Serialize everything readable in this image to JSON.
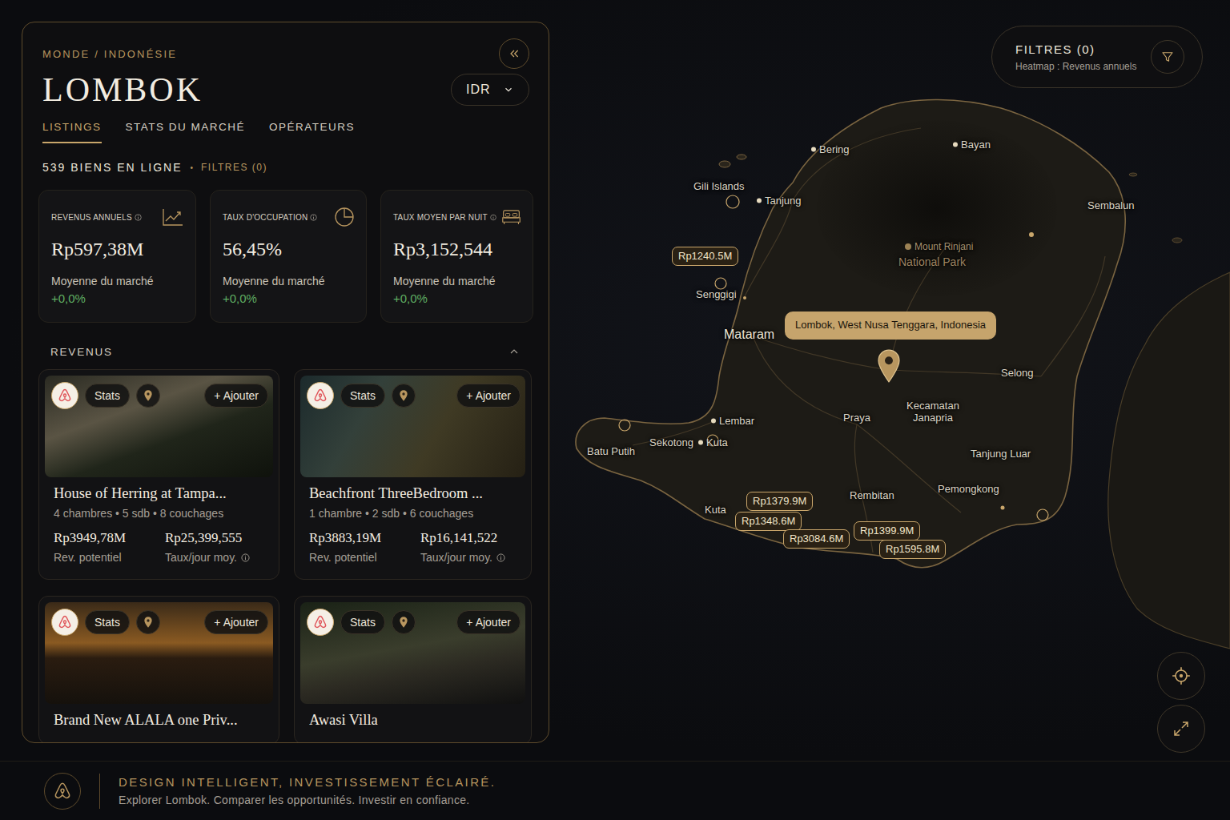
{
  "breadcrumb": "MONDE / INDONÉSIE",
  "title": "LOMBOK",
  "currency": {
    "value": "IDR"
  },
  "tabs": [
    {
      "label": "LISTINGS",
      "selected": true
    },
    {
      "label": "STATS DU MARCHÉ",
      "selected": false
    },
    {
      "label": "OPÉRATEURS",
      "selected": false
    }
  ],
  "summary": {
    "count": "539 BIENS EN LIGNE",
    "separator": "•",
    "filters": "FILTRES (0)"
  },
  "stats": [
    {
      "label": "REVENUS ANNUELS",
      "value": "Rp597,38M",
      "caption": "Moyenne du marché",
      "change": "+0,0%",
      "kind": "revenue"
    },
    {
      "label": "TAUX D'OCCUPATION",
      "value": "56,45%",
      "caption": "Moyenne du marché",
      "change": "+0,0%",
      "kind": "occupancy"
    },
    {
      "label": "TAUX MOYEN PAR NUIT",
      "value": "Rp3,152,544",
      "caption": "Moyenne du marché",
      "change": "+0,0%",
      "kind": "rate"
    }
  ],
  "section": {
    "title": "REVENUS",
    "expanded": true
  },
  "card_actions": {
    "stats": "Stats",
    "add": "+ Ajouter"
  },
  "listings": [
    {
      "title": "House of Herring at Tampa...",
      "details": "4 chambres • 5 sdb • 8 couchages",
      "potential": "Rp3949,78M",
      "potential_label": "Rev. potentiel",
      "rate": "Rp25,399,555",
      "rate_label": "Taux/jour moy."
    },
    {
      "title": "Beachfront ThreeBedroom ...",
      "details": "1 chambre • 2 sdb • 6 couchages",
      "potential": "Rp3883,19M",
      "potential_label": "Rev. potentiel",
      "rate": "Rp16,141,522",
      "rate_label": "Taux/jour moy."
    },
    {
      "title": "Brand New ALALA one Priv..."
    },
    {
      "title": "Awasi Villa"
    }
  ],
  "map": {
    "filters": {
      "title": "FILTRES (0)",
      "subtitle": "Heatmap : Revenus annuels"
    },
    "tooltip": "Lombok, West Nusa Tenggara, Indonesia",
    "places": [
      {
        "name": "Bering",
        "kind": "town",
        "marker": true
      },
      {
        "name": "Bayan",
        "kind": "town",
        "marker": true
      },
      {
        "name": "Gili Islands",
        "kind": "town",
        "marker": false
      },
      {
        "name": "Tanjung",
        "kind": "town",
        "marker": true
      },
      {
        "name": "Sembalun",
        "kind": "town",
        "marker": false
      },
      {
        "name": "Mount Rinjani",
        "kind": "peak",
        "marker": true
      },
      {
        "name": "National Park",
        "kind": "park",
        "marker": false
      },
      {
        "name": "Senggigi",
        "kind": "town",
        "marker": false
      },
      {
        "name": "Mataram",
        "kind": "city",
        "marker": false
      },
      {
        "name": "Selong",
        "kind": "town",
        "marker": false
      },
      {
        "name": "Lembar",
        "kind": "town",
        "marker": true
      },
      {
        "name": "Praya",
        "kind": "town",
        "marker": false
      },
      {
        "name": "Kecamatan Janapria",
        "kind": "town",
        "marker": false
      },
      {
        "name": "Batu Putih",
        "kind": "town",
        "marker": false
      },
      {
        "name": "Sekotong",
        "kind": "town",
        "marker": false
      },
      {
        "name": "Kuta",
        "kind": "town",
        "marker": true
      },
      {
        "name": "Tanjung Luar",
        "kind": "town",
        "marker": false
      },
      {
        "name": "Rembitan",
        "kind": "town",
        "marker": false
      },
      {
        "name": "Pemongkong",
        "kind": "town",
        "marker": false
      },
      {
        "name": "Kuta",
        "kind": "town",
        "marker": false
      }
    ],
    "prices": [
      "Rp1240.5M",
      "Rp1379.9M",
      "Rp1348.6M",
      "Rp3084.6M",
      "Rp1399.9M",
      "Rp1595.8M"
    ]
  },
  "footer": {
    "tagline": "DESIGN INTELLIGENT, INVESTISSEMENT ÉCLAIRÉ.",
    "subtitle": "Explorer Lombok. Comparer les opportunités. Investir en confiance."
  }
}
